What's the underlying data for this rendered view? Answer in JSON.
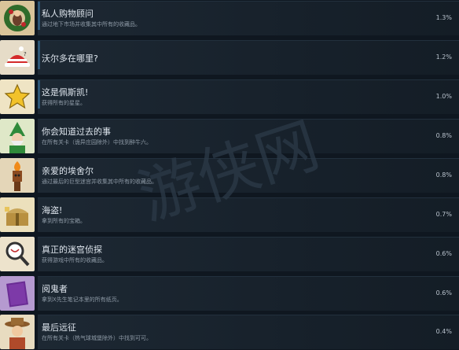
{
  "achievements": [
    {
      "title": "私人购物顾问",
      "desc": "通过地下市场并收集其中所有的收藏品。",
      "pct": "1.3%",
      "icon": "elf-with-wreath-icon",
      "progress_bar": true
    },
    {
      "title": "沃尔多在哪里?",
      "desc": "",
      "pct": "1.2%",
      "icon": "red-striped-hat-icon",
      "progress_bar": true
    },
    {
      "title": "这是佩斯凯!",
      "desc": "获得所有的星星。",
      "pct": "1.0%",
      "icon": "gold-star-icon",
      "progress_bar": true
    },
    {
      "title": "你会知道过去的事",
      "desc": "在所有关卡（诡异庄园除外）中找到醉牛六。",
      "pct": "0.8%",
      "icon": "green-wizard-icon",
      "progress_bar": false
    },
    {
      "title": "亲爱的埃舍尔",
      "desc": "通过最后的巨型迷宫并收集其中所有的收藏品。",
      "pct": "0.8%",
      "icon": "tiki-torch-icon",
      "progress_bar": false
    },
    {
      "title": "海盗!",
      "desc": "拿到所有的宝箱。",
      "pct": "0.7%",
      "icon": "treasure-chest-icon",
      "progress_bar": false
    },
    {
      "title": "真正的迷宫侦探",
      "desc": "获得游戏中所有的收藏品。",
      "pct": "0.6%",
      "icon": "magnifying-glass-icon",
      "progress_bar": false
    },
    {
      "title": "阅鬼者",
      "desc": "拿到X先生笔记本里的所有纸页。",
      "pct": "0.6%",
      "icon": "purple-notebook-icon",
      "progress_bar": false
    },
    {
      "title": "最后远征",
      "desc": "在所有关卡（热气球城堡除外）中找到可可。",
      "pct": "0.4%",
      "icon": "explorer-girl-icon",
      "progress_bar": false
    }
  ],
  "watermark": "游侠网",
  "colors": {
    "background": "#0f1720",
    "panel": "#1d2833",
    "bar": "#2e5777",
    "title": "#dfe6ee",
    "desc": "#8e9aa6"
  }
}
